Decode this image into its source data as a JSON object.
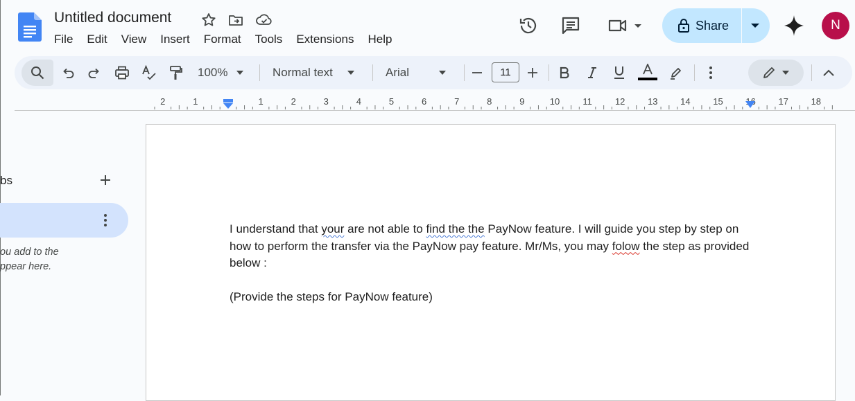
{
  "document": {
    "title": "Untitled document"
  },
  "menu": [
    "File",
    "Edit",
    "View",
    "Insert",
    "Format",
    "Tools",
    "Extensions",
    "Help"
  ],
  "header": {
    "share_label": "Share",
    "avatar_initial": "N"
  },
  "toolbar": {
    "zoom": "100%",
    "style": "Normal text",
    "font": "Arial",
    "font_size": "11"
  },
  "ruler": {
    "numbers": [
      "2",
      "1",
      "1",
      "2",
      "3",
      "4",
      "5",
      "6",
      "7",
      "8",
      "9",
      "10",
      "11",
      "12",
      "13",
      "14",
      "15",
      "16",
      "17",
      "18"
    ]
  },
  "sidebar": {
    "tabs_label": "bs",
    "hint_line1": "ou add to the",
    "hint_line2": "ppear here."
  },
  "body": {
    "p1_a": "I understand that ",
    "p1_err1": "your",
    "p1_b": " are not able to ",
    "p1_err2": "find the the",
    "p1_c": " PayNow feature. I will guide you step by step on how to perform the transfer via the PayNow pay feature. Mr/Ms, you may ",
    "p1_err3": "folow",
    "p1_d": " the step as provided below :",
    "p2": " (Provide the steps for PayNow feature)"
  },
  "colors": {
    "share_bg": "#c2e7ff",
    "avatar_bg": "#b80f4a",
    "toolbar_bg": "#edf2fa",
    "accent_blue": "#4285f4"
  }
}
